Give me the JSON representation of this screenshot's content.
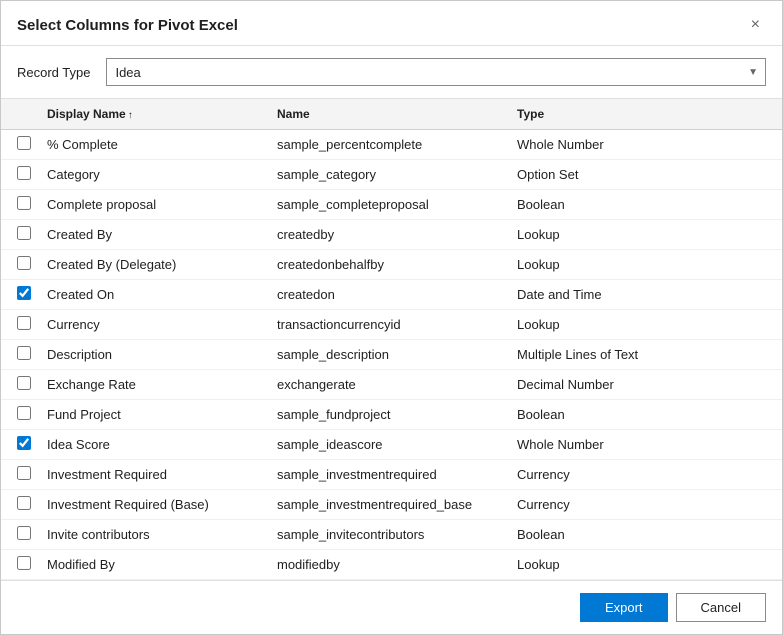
{
  "dialog": {
    "title": "Select Columns for Pivot Excel",
    "close_label": "×"
  },
  "record_type": {
    "label": "Record Type",
    "value": "Idea",
    "options": [
      "Idea"
    ]
  },
  "table": {
    "columns": [
      {
        "key": "checkbox",
        "label": ""
      },
      {
        "key": "display_name",
        "label": "Display Name",
        "sort": "↑"
      },
      {
        "key": "name",
        "label": "Name"
      },
      {
        "key": "type",
        "label": "Type"
      }
    ],
    "rows": [
      {
        "checked": false,
        "display_name": "% Complete",
        "name": "sample_percentcomplete",
        "type": "Whole Number"
      },
      {
        "checked": false,
        "display_name": "Category",
        "name": "sample_category",
        "type": "Option Set"
      },
      {
        "checked": false,
        "display_name": "Complete proposal",
        "name": "sample_completeproposal",
        "type": "Boolean"
      },
      {
        "checked": false,
        "display_name": "Created By",
        "name": "createdby",
        "type": "Lookup"
      },
      {
        "checked": false,
        "display_name": "Created By (Delegate)",
        "name": "createdonbehalfby",
        "type": "Lookup"
      },
      {
        "checked": true,
        "display_name": "Created On",
        "name": "createdon",
        "type": "Date and Time"
      },
      {
        "checked": false,
        "display_name": "Currency",
        "name": "transactioncurrencyid",
        "type": "Lookup"
      },
      {
        "checked": false,
        "display_name": "Description",
        "name": "sample_description",
        "type": "Multiple Lines of Text"
      },
      {
        "checked": false,
        "display_name": "Exchange Rate",
        "name": "exchangerate",
        "type": "Decimal Number"
      },
      {
        "checked": false,
        "display_name": "Fund Project",
        "name": "sample_fundproject",
        "type": "Boolean"
      },
      {
        "checked": true,
        "display_name": "Idea Score",
        "name": "sample_ideascore",
        "type": "Whole Number"
      },
      {
        "checked": false,
        "display_name": "Investment Required",
        "name": "sample_investmentrequired",
        "type": "Currency"
      },
      {
        "checked": false,
        "display_name": "Investment Required (Base)",
        "name": "sample_investmentrequired_base",
        "type": "Currency"
      },
      {
        "checked": false,
        "display_name": "Invite contributors",
        "name": "sample_invitecontributors",
        "type": "Boolean"
      },
      {
        "checked": false,
        "display_name": "Modified By",
        "name": "modifiedby",
        "type": "Lookup"
      }
    ]
  },
  "footer": {
    "export_label": "Export",
    "cancel_label": "Cancel"
  }
}
